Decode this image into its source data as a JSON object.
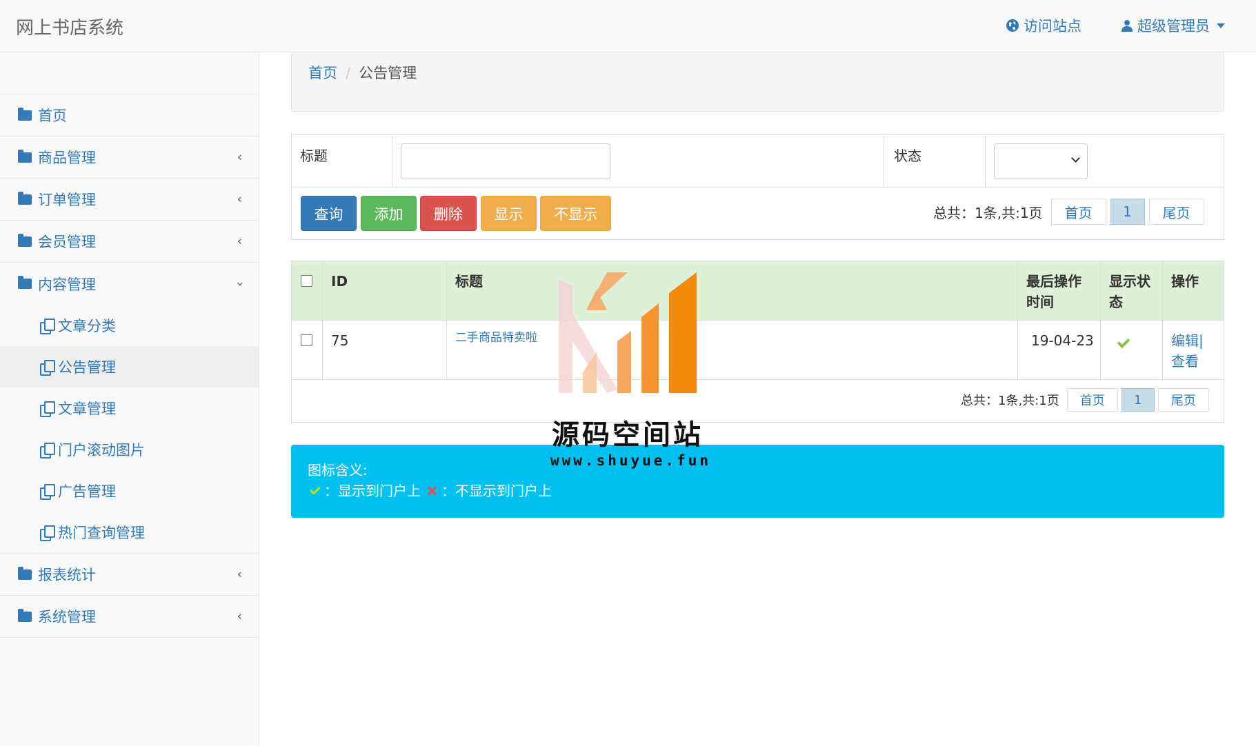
{
  "navbar": {
    "brand": "网上书店系统",
    "visit_site": "访问站点",
    "admin_user": "超级管理员"
  },
  "sidebar": {
    "items": [
      {
        "label": "首页"
      },
      {
        "label": "商品管理"
      },
      {
        "label": "订单管理"
      },
      {
        "label": "会员管理"
      },
      {
        "label": "内容管理"
      }
    ],
    "content_sub": [
      {
        "label": "文章分类"
      },
      {
        "label": "公告管理"
      },
      {
        "label": "文章管理"
      },
      {
        "label": "门户滚动图片"
      },
      {
        "label": "广告管理"
      },
      {
        "label": "热门查询管理"
      }
    ],
    "bottom_items": [
      {
        "label": "报表统计"
      },
      {
        "label": "系统管理"
      }
    ]
  },
  "breadcrumb": {
    "home": "首页",
    "separator": "/",
    "current": "公告管理"
  },
  "search": {
    "title_label": "标题",
    "title_value": "",
    "status_label": "状态",
    "status_value": ""
  },
  "buttons": {
    "query": "查询",
    "add": "添加",
    "delete": "删除",
    "show": "显示",
    "hide": "不显示"
  },
  "pagination": {
    "total_text": "总共：1条,共:1页",
    "first": "首页",
    "current_page": "1",
    "last": "尾页"
  },
  "table": {
    "headers": {
      "id": "ID",
      "title": "标题",
      "last_time_line1": "最后操作",
      "last_time_line2": "时间",
      "status_line1": "显示状",
      "status_line2": "态",
      "actions": "操作"
    },
    "rows": [
      {
        "id": "75",
        "title": "二手商品特卖啦",
        "last_time": "19-04-23",
        "status": "shown",
        "edit": "编辑|",
        "view": "查看"
      }
    ]
  },
  "info": {
    "title": "图标含义:",
    "shown_text": "：显示到门户上",
    "hidden_text": "：不显示到门户上"
  },
  "watermark": {
    "name": "源码空间站",
    "url": "www.shuyue.fun"
  },
  "colors": {
    "primary": "#337ab7",
    "success": "#5cb85c",
    "danger": "#d9534f",
    "warning": "#f0ad4e",
    "info": "#00c0ef",
    "table_header": "#dff0d8"
  }
}
